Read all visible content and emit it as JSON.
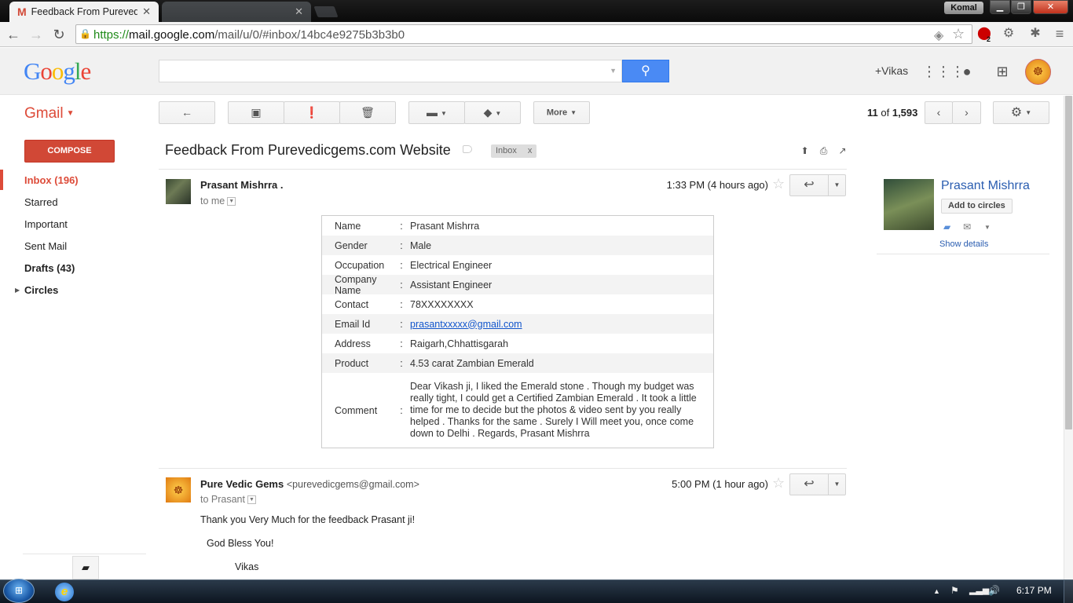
{
  "browser": {
    "active_tab_title": "Feedback From Purevedic",
    "inactive_tab_title": "",
    "user_badge": "Komal",
    "url_scheme": "https://",
    "url_host": "mail.google.com",
    "url_rest": "/mail/u/0/#inbox/14bc4e9275b3b3b0",
    "extension_badge": "2"
  },
  "header": {
    "logo_letters": [
      "G",
      "o",
      "o",
      "g",
      "l",
      "e"
    ],
    "plus_user": "+Vikas"
  },
  "toolbar": {
    "gmail_label": "Gmail",
    "more_label": "More",
    "pager_current": "11",
    "pager_of": "of",
    "pager_total": "1,593"
  },
  "sidebar": {
    "compose_label": "COMPOSE",
    "items": [
      {
        "label": "Inbox (196)"
      },
      {
        "label": "Starred"
      },
      {
        "label": "Important"
      },
      {
        "label": "Sent Mail"
      },
      {
        "label": "Drafts (43)"
      },
      {
        "label": "Circles"
      }
    ]
  },
  "thread": {
    "subject": "Feedback From Purevedicgems.com Website",
    "label_tag": "Inbox",
    "label_remove": "x"
  },
  "message1": {
    "sender": "Prasant Mishrra .",
    "recipient": "to me",
    "time": "1:33 PM (4 hours ago)",
    "fields": [
      {
        "key": "Name",
        "value": "Prasant Mishrra"
      },
      {
        "key": "Gender",
        "value": "Male"
      },
      {
        "key": "Occupation",
        "value": "Electrical Engineer"
      },
      {
        "key": "Company Name",
        "value": "Assistant Engineer"
      },
      {
        "key": "Contact",
        "value": "78XXXXXXXX"
      },
      {
        "key": "Email Id",
        "value": "prasantxxxxx@gmail.com"
      },
      {
        "key": "Address",
        "value": "Raigarh,Chhattisgarah"
      },
      {
        "key": "Product",
        "value": "4.53 carat Zambian Emerald"
      },
      {
        "key": "Comment",
        "value": "Dear Vikash ji, I liked the Emerald stone . Though my budget was really tight, I could get a Certified Zambian Emerald . It took a little time for me to decide but the photos & video sent by you really helped . Thanks for the same . Surely I Will meet you, once come down to Delhi . Regards, Prasant Mishrra"
      }
    ],
    "colon": ":"
  },
  "message2": {
    "sender": "Pure Vedic Gems",
    "sender_email": "<purevedicgems@gmail.com>",
    "recipient": "to Prasant",
    "time": "5:00 PM (1 hour ago)",
    "line1": "Thank you Very Much for the feedback Prasant ji!",
    "line2": "God Bless You!",
    "line3": "Vikas"
  },
  "contact_card": {
    "name": "Prasant Mishrra",
    "add_to_circles": "Add to circles",
    "show_details": "Show details"
  },
  "taskbar": {
    "clock": "6:17 PM"
  },
  "colors": {
    "gmail_red": "#dd4b39",
    "compose_red": "#d14836",
    "search_blue": "#4a8af4",
    "link_blue": "#15c",
    "contact_blue": "#2a5db0"
  }
}
